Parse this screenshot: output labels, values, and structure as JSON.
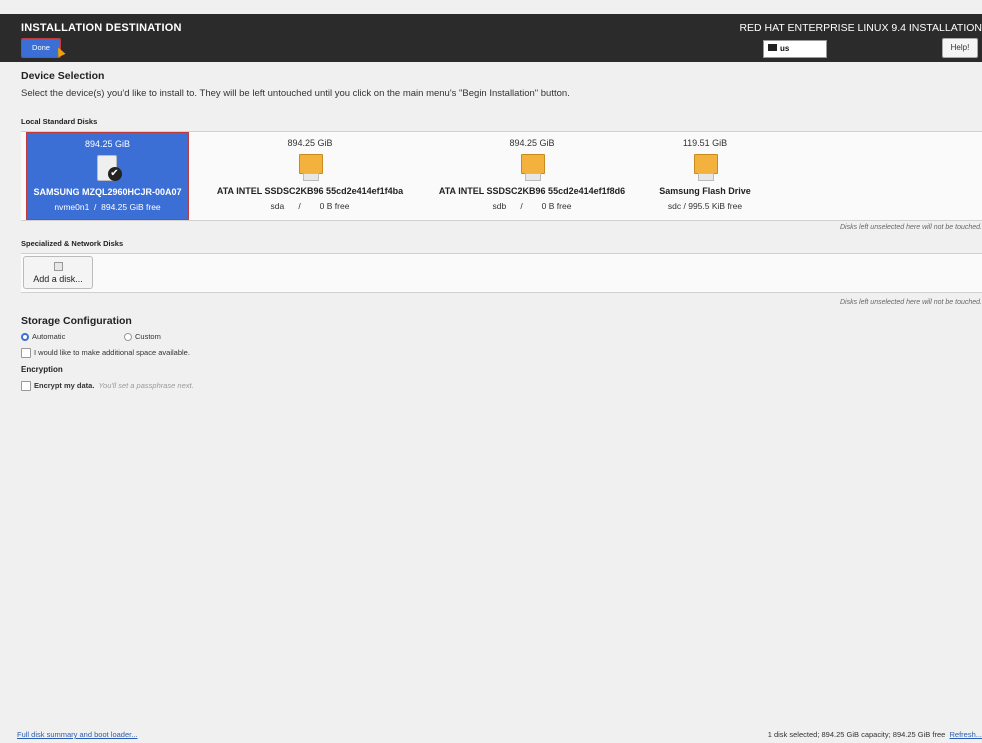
{
  "header": {
    "title": "INSTALLATION DESTINATION",
    "done_label": "Done",
    "product": "RED HAT ENTERPRISE LINUX 9.4 INSTALLATION",
    "keyboard": "us",
    "help_label": "Help!"
  },
  "device_selection": {
    "title": "Device Selection",
    "description": "Select the device(s) you'd like to install to.  They will be left untouched until you click on the main menu's \"Begin Installation\" button."
  },
  "local_disks": {
    "heading": "Local Standard Disks",
    "note": "Disks left unselected here will not be touched.",
    "disks": [
      {
        "size": "894.25 GiB",
        "name": "SAMSUNG MZQL2960HCJR-00A07",
        "detail": "nvme0n1  /  894.25 GiB free",
        "selected": true
      },
      {
        "size": "894.25 GiB",
        "name": "ATA INTEL SSDSC2KB96 55cd2e414ef1f4ba",
        "detail": "sda      /        0 B free",
        "selected": false
      },
      {
        "size": "894.25 GiB",
        "name": "ATA INTEL SSDSC2KB96 55cd2e414ef1f8d6",
        "detail": "sdb      /        0 B free",
        "selected": false
      },
      {
        "size": "119.51 GiB",
        "name": "Samsung Flash Drive",
        "detail": "sdc / 995.5 KiB free",
        "selected": false
      }
    ]
  },
  "network_disks": {
    "heading": "Specialized & Network Disks",
    "add_label": "Add a disk...",
    "note": "Disks left unselected here will not be touched."
  },
  "storage": {
    "title": "Storage Configuration",
    "automatic": "Automatic",
    "custom": "Custom",
    "selected": "Automatic",
    "additional_space": "I would like to make additional space available."
  },
  "encryption": {
    "heading": "Encryption",
    "label": "Encrypt my data.",
    "hint": "You'll set a passphrase next."
  },
  "footer": {
    "summary_link": "Full disk summary and boot loader...",
    "status": "1 disk selected; 894.25 GiB capacity; 894.25 GiB free",
    "refresh": "Refresh..."
  }
}
